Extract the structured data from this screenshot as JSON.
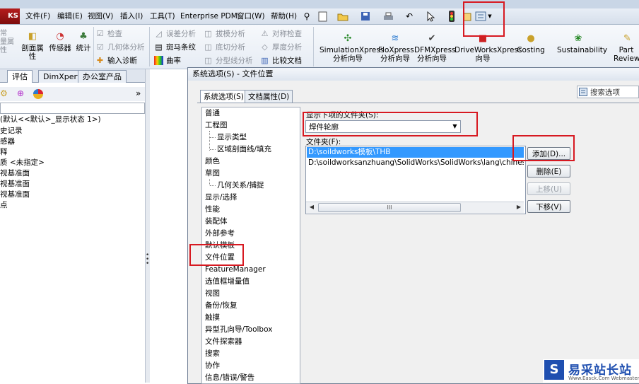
{
  "app": {
    "logo_text": "KS",
    "menu": [
      "文件(F)",
      "编辑(E)",
      "视图(V)",
      "插入(I)",
      "工具(T)",
      "Enterprise PDM",
      "窗口(W)",
      "帮助(H)"
    ],
    "toolbar_icons": [
      "pin-icon",
      "new-document-icon",
      "open-folder-icon",
      "save-icon",
      "print-icon",
      "undo-icon",
      "select-arrow-icon",
      "traffic-light-icon",
      "rebuild-icon",
      "options-icon"
    ]
  },
  "ribbon": {
    "left_partial": [
      "常",
      "量属",
      "性"
    ],
    "section_props": "剖面属\n性",
    "sensors": "传感器",
    "stats": "统计",
    "check_col": [
      "检查",
      "几何体分析",
      "输入诊断"
    ],
    "analysis_col1": [
      "误差分析",
      "斑马条纹",
      "曲率"
    ],
    "analysis_col2": [
      "拔模分析",
      "底切分析",
      "分型线分析"
    ],
    "analysis_col3": [
      "对称检查",
      "厚度分析",
      "比较文档"
    ],
    "big_buttons": [
      {
        "label": "SimulationXpress\n分析向导",
        "icon": "simulation-icon"
      },
      {
        "label": "FloXpress\n分析向导",
        "icon": "floxpress-icon"
      },
      {
        "label": "DFMXpress\n分析向导",
        "icon": "dfmxpress-icon"
      },
      {
        "label": "DriveWorksXpress\n向导",
        "icon": "driveworks-icon"
      },
      {
        "label": "Costing",
        "icon": "costing-icon"
      },
      {
        "label": "Sustainability",
        "icon": "sustainability-icon"
      },
      {
        "label": "Part\nReviewe",
        "icon": "part-reviewer-icon"
      }
    ]
  },
  "left_panel": {
    "tabs": [
      "评估",
      "DimXpert",
      "办公室产品"
    ],
    "expand": "»",
    "tree": [
      "(默认<<默认>_显示状态 1>)",
      "史记录",
      "感器",
      "释",
      "质 <未指定>",
      "视基准面",
      "视基准面",
      "视基准面",
      "点"
    ]
  },
  "dialog": {
    "title": "系统选项(S) - 文件位置",
    "tabs": [
      "系统选项(S)",
      "文档属性(D)"
    ],
    "search_placeholder": "搜索选项",
    "nav": [
      {
        "label": "普通",
        "level": 0
      },
      {
        "label": "工程图",
        "level": 0
      },
      {
        "label": "显示类型",
        "level": 1
      },
      {
        "label": "区域剖面线/填充",
        "level": 1
      },
      {
        "label": "颜色",
        "level": 0
      },
      {
        "label": "草图",
        "level": 0
      },
      {
        "label": "几何关系/捕捉",
        "level": 1
      },
      {
        "label": "显示/选择",
        "level": 0
      },
      {
        "label": "性能",
        "level": 0
      },
      {
        "label": "装配体",
        "level": 0
      },
      {
        "label": "外部参考",
        "level": 0
      },
      {
        "label": "默认模板",
        "level": 0
      },
      {
        "label": "文件位置",
        "level": 0
      },
      {
        "label": "FeatureManager",
        "level": 0
      },
      {
        "label": "选值框增量值",
        "level": 0
      },
      {
        "label": "视图",
        "level": 0
      },
      {
        "label": "备份/恢复",
        "level": 0
      },
      {
        "label": "触摸",
        "level": 0
      },
      {
        "label": "异型孔向导/Toolbox",
        "level": 0
      },
      {
        "label": "文件探索器",
        "level": 0
      },
      {
        "label": "搜索",
        "level": 0
      },
      {
        "label": "协作",
        "level": 0
      },
      {
        "label": "信息/错误/警告",
        "level": 0
      }
    ],
    "show_folders_label": "显示下项的文件夹(S):",
    "show_folders_value": "焊件轮廓",
    "folders_label": "文件夹(F):",
    "folders": [
      {
        "path": "D:\\soildworks模板\\THB",
        "selected": true
      },
      {
        "path": "D:\\soildworksanzhuang\\SolidWorks\\SolidWorks\\lang\\chinese-simplifie",
        "selected": false
      }
    ],
    "scroll_thumb": "III",
    "buttons": {
      "add": "添加(D)...",
      "delete": "删除(E)",
      "up": "上移(U)",
      "down": "下移(V)"
    }
  },
  "watermark": {
    "logo": "S",
    "text": "易采站长站",
    "sub": "Www.Easck.Com  Webmaster"
  },
  "colors": {
    "highlight_red": "#d71921",
    "selection_blue": "#3399ff",
    "watermark_blue": "#1f4fb0"
  }
}
